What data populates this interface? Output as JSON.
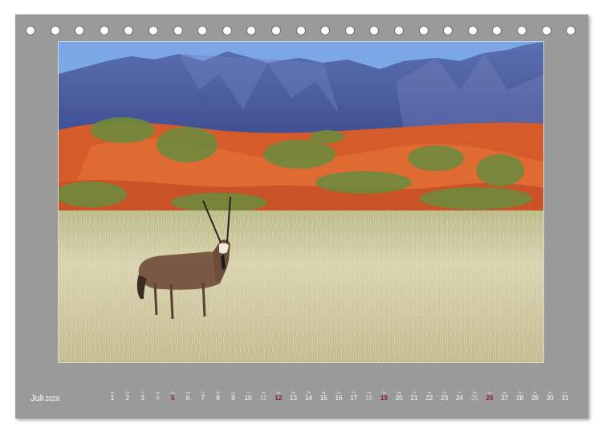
{
  "month": {
    "name": "Juli",
    "year": "2026"
  },
  "days": [
    {
      "wd": "Mi",
      "num": "1",
      "kind": "weekday"
    },
    {
      "wd": "Do",
      "num": "2",
      "kind": "weekday"
    },
    {
      "wd": "Fr",
      "num": "3",
      "kind": "weekday"
    },
    {
      "wd": "Sa",
      "num": "4",
      "kind": "sat"
    },
    {
      "wd": "So",
      "num": "5",
      "kind": "sun"
    },
    {
      "wd": "Mo",
      "num": "6",
      "kind": "weekday"
    },
    {
      "wd": "Di",
      "num": "7",
      "kind": "weekday"
    },
    {
      "wd": "Mi",
      "num": "8",
      "kind": "weekday"
    },
    {
      "wd": "Do",
      "num": "9",
      "kind": "weekday"
    },
    {
      "wd": "Fr",
      "num": "10",
      "kind": "weekday"
    },
    {
      "wd": "Sa",
      "num": "11",
      "kind": "sat"
    },
    {
      "wd": "So",
      "num": "12",
      "kind": "sun"
    },
    {
      "wd": "Mo",
      "num": "13",
      "kind": "weekday"
    },
    {
      "wd": "Di",
      "num": "14",
      "kind": "weekday"
    },
    {
      "wd": "Mi",
      "num": "15",
      "kind": "weekday"
    },
    {
      "wd": "Do",
      "num": "16",
      "kind": "weekday"
    },
    {
      "wd": "Fr",
      "num": "17",
      "kind": "weekday"
    },
    {
      "wd": "Sa",
      "num": "18",
      "kind": "sat"
    },
    {
      "wd": "So",
      "num": "19",
      "kind": "sun"
    },
    {
      "wd": "Mo",
      "num": "20",
      "kind": "weekday"
    },
    {
      "wd": "Di",
      "num": "21",
      "kind": "weekday"
    },
    {
      "wd": "Mi",
      "num": "22",
      "kind": "weekday"
    },
    {
      "wd": "Do",
      "num": "23",
      "kind": "weekday"
    },
    {
      "wd": "Fr",
      "num": "24",
      "kind": "weekday"
    },
    {
      "wd": "Sa",
      "num": "25",
      "kind": "sat"
    },
    {
      "wd": "So",
      "num": "26",
      "kind": "sun"
    },
    {
      "wd": "Mo",
      "num": "27",
      "kind": "weekday"
    },
    {
      "wd": "Di",
      "num": "28",
      "kind": "weekday"
    },
    {
      "wd": "Mi",
      "num": "29",
      "kind": "weekday"
    },
    {
      "wd": "Do",
      "num": "30",
      "kind": "weekday"
    },
    {
      "wd": "Fr",
      "num": "31",
      "kind": "weekday"
    }
  ],
  "colors": {
    "page_background": "#9a9a9a",
    "sunday_red": "#8a1c2c",
    "text": "#ffffff"
  },
  "photo": {
    "subject": "oryx-icon"
  }
}
